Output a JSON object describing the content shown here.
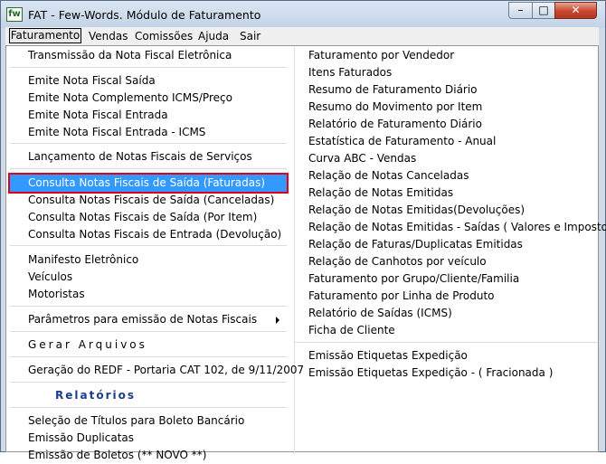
{
  "window": {
    "title": "FAT - Few-Words. Módulo de Faturamento",
    "icon_label": "fw",
    "controls": {
      "minimize": "–",
      "maximize": "□",
      "close": "✕"
    }
  },
  "menubar": [
    "Faturamento",
    "Vendas",
    "Comissões",
    "Ajuda",
    "Sair"
  ],
  "menu_left": [
    "Transmissão da Nota Fiscal Eletrônica",
    "Emite Nota Fiscal Saída",
    "Emite Nota Complemento ICMS/Preço",
    "Emite Nota Fiscal Entrada",
    "Emite Nota Fiscal Entrada - ICMS",
    "Lançamento de Notas Fiscais de Serviços",
    "Consulta Notas Fiscais de Saída (Faturadas)",
    "Consulta Notas Fiscais de Saída (Canceladas)",
    "Consulta Notas Fiscais de Saída (Por Item)",
    "Consulta Notas Fiscais de Entrada (Devolução)",
    "Manifesto Eletrônico",
    "Veículos",
    "Motoristas",
    "Parâmetros para emissão de Notas Fiscais",
    "Gerar Arquivos",
    "Geração do REDF - Portaria CAT 102, de 9/11/2007",
    "Relatórios",
    "Seleção de Títulos para Boleto Bancário",
    "Emissão Duplicatas",
    "Emissão de Boletos (** NOVO **)"
  ],
  "menu_right": [
    "Faturamento por Vendedor",
    "Itens Faturados",
    "Resumo de Faturamento Diário",
    "Resumo do Movimento por Item",
    "Relatório de Faturamento Diário",
    "Estatística de Faturamento - Anual",
    "Curva ABC - Vendas",
    "Relação de Notas Canceladas",
    "Relação de Notas Emitidas",
    "Relação de Notas Emitidas(Devoluções)",
    "Relação de Notas Emitidas - Saídas ( Valores e Impostos )",
    "Relação de Faturas/Duplicatas Emitidas",
    "Relação de Canhotos por veículo",
    "Faturamento por Grupo/Cliente/Familia",
    "Faturamento por Linha de Produto",
    "Relatório de  Saídas (ICMS)",
    "Ficha de Cliente",
    "Emissão Etiquetas Expedição",
    "Emissão Etiquetas Expedição - ( Fracionada )"
  ],
  "highlighted_item": "Consulta Notas Fiscais de Saída (Faturadas)",
  "colors": {
    "highlight": "#3399ff",
    "highlight_border": "#e0001c",
    "relatorios_text": "#1e3c8c"
  }
}
